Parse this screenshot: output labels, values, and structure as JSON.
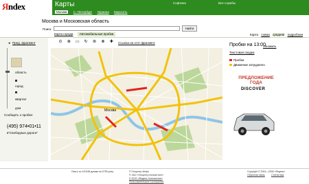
{
  "header": {
    "logo_first": "Я",
    "logo_rest": "ndex",
    "service_title": "Карты",
    "links": [
      "Софтина",
      "Все службы"
    ],
    "nav": [
      "Москва",
      "С.-Петербург",
      "Украина",
      "Евросеть"
    ],
    "nav_active_index": 0
  },
  "main": {
    "title": "Москва и Московская область",
    "search": {
      "label": "Поиск",
      "value": "",
      "button": "Найти"
    },
    "tabs": [
      "Карта города",
      "Автомобильные пробки"
    ],
    "active_tab_index": 1,
    "map_type": {
      "label": "Карта",
      "options": [
        "схема",
        "средняя",
        "подробная"
      ],
      "selected_index": 1
    }
  },
  "left": {
    "print_link": "Пред. фрагмент",
    "legend": [
      "область",
      "город",
      "квартал",
      "дом"
    ],
    "traffic_message": "Сообщить о пробке:",
    "phone": "(495) 974•01•11",
    "radio": "в\"Свободные дороги\""
  },
  "toolbar": {
    "icons": [
      "⊙",
      "⊕",
      "▭",
      "↻",
      "⊚",
      "⊗",
      "✚"
    ],
    "fragment_link": "Ссылка на этот фрагмент"
  },
  "map": {
    "city_label": "Москва",
    "colors": {
      "base": "#f3efe1",
      "road": "#f2c20a",
      "park": "#bcd79a",
      "water": "#8ec5e8"
    }
  },
  "right": {
    "traffic_title": "Пробки на 13:00",
    "refresh": "обновить",
    "text_summary": "Текстовая сводка",
    "legend": [
      "Пробка",
      "Движение затруднено"
    ],
    "legend_colors": [
      "#e2231a",
      "#f2c20a"
    ],
    "ad_title": "ПРЕДЛОЖЕНИЕ ГОДА",
    "ad_brand": "DISCOVER"
  },
  "footer": {
    "left": "Пиксо по 120198 домам на 0795 улиц",
    "center": [
      "© Геоцентр-Инфо",
      "© ЗАО «Геоцентр-Консалтинг»",
      "© ООО «Яндекс. Консалтинг»",
      "Пользовательское соглашение"
    ],
    "right": [
      "Copyright © 2004—2006 «Яндекс»",
      "Обратная связь",
      "Статистика"
    ]
  }
}
